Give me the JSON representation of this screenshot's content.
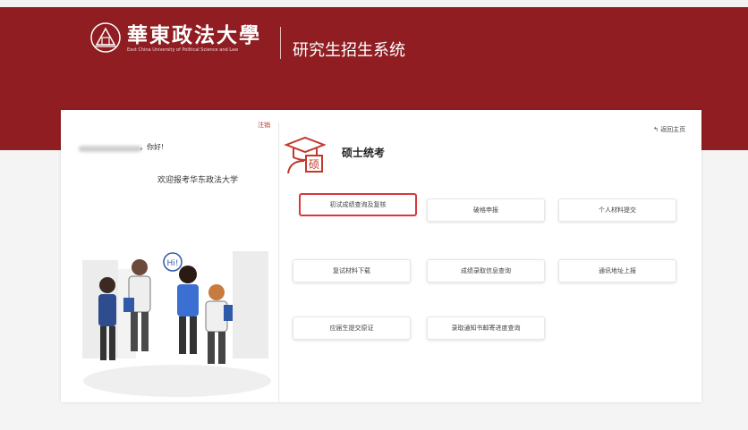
{
  "header": {
    "university_name_cn": "華東政法大學",
    "university_name_en": "East China University of Political Science and Law",
    "system_title": "研究生招生系统"
  },
  "user_panel": {
    "logout_label": "注销",
    "greeting_suffix": "，你好!",
    "welcome_text": "欢迎报考华东政法大学",
    "illustration_speech": "Hi!"
  },
  "main": {
    "section_title": "硕士统考",
    "section_icon_text": "硕",
    "back_home_label": "返回主页",
    "buttons": [
      {
        "label": "初试成绩查询及复核",
        "highlighted": true
      },
      {
        "label": "破格申报",
        "highlighted": false
      },
      {
        "label": "个人材料提交",
        "highlighted": false
      },
      {
        "label": "复试材料下载",
        "highlighted": false
      },
      {
        "label": "成绩录取信息查询",
        "highlighted": false
      },
      {
        "label": "通讯地址上报",
        "highlighted": false
      },
      {
        "label": "应届生提交原证",
        "highlighted": false
      },
      {
        "label": "录取通知书邮寄进度查询",
        "highlighted": false
      }
    ]
  },
  "colors": {
    "banner": "#8f1d21",
    "highlight_border": "#d9373b"
  }
}
